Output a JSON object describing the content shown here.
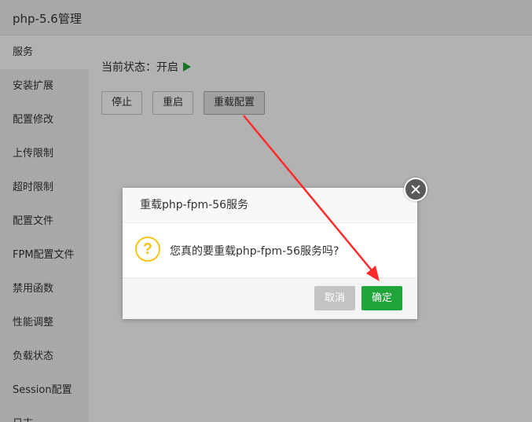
{
  "window": {
    "title": "php-5.6管理"
  },
  "sidebar": {
    "items": [
      {
        "label": "服务"
      },
      {
        "label": "安装扩展"
      },
      {
        "label": "配置修改"
      },
      {
        "label": "上传限制"
      },
      {
        "label": "超时限制"
      },
      {
        "label": "配置文件"
      },
      {
        "label": "FPM配置文件"
      },
      {
        "label": "禁用函数"
      },
      {
        "label": "性能调整"
      },
      {
        "label": "负载状态"
      },
      {
        "label": "Session配置"
      },
      {
        "label": "日志"
      }
    ]
  },
  "main": {
    "status_text": "当前状态：开启",
    "buttons": {
      "stop": "停止",
      "restart": "重启",
      "reload": "重载配置"
    }
  },
  "dialog": {
    "title": "重载php-fpm-56服务",
    "question": "您真的要重载php-fpm-56服务吗?",
    "cancel_label": "取消",
    "confirm_label": "确定"
  },
  "colors": {
    "accent": "#20a53a",
    "warning": "#f5c518",
    "annotation": "#ff2a2a"
  }
}
